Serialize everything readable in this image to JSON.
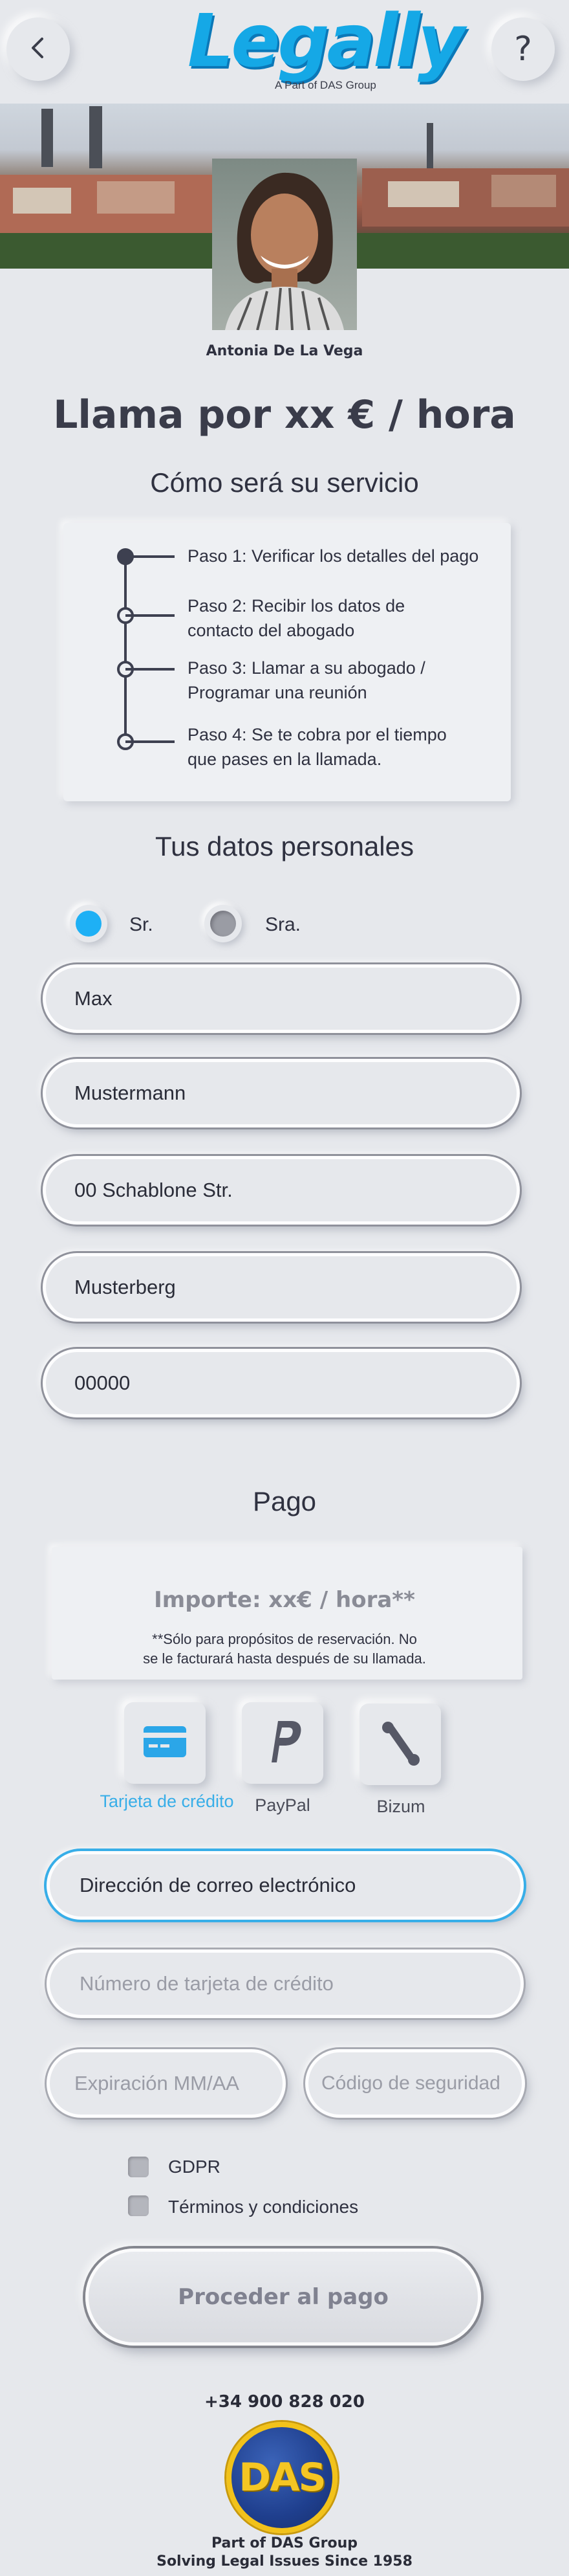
{
  "header": {
    "logo_text": "Legally",
    "logo_sub": "A Part of DAS Group",
    "back_icon": "chevron-left-icon",
    "help_icon": "question-icon"
  },
  "lawyer": {
    "name": "Antonia De La Vega"
  },
  "headline": "Llama por xx € / hora",
  "steps_title": "Cómo será su servicio",
  "steps": [
    {
      "lines": [
        "Paso 1: Verificar los detalles del pago"
      ]
    },
    {
      "lines": [
        "Paso 2: Recibir los datos de",
        "contacto del abogado"
      ]
    },
    {
      "lines": [
        "Paso 3: Llamar a su abogado /",
        "Programar una reunión"
      ]
    },
    {
      "lines": [
        "Paso 4: Se te cobra por el tiempo",
        "que pases en la llamada."
      ]
    }
  ],
  "personal": {
    "title": "Tus datos personales",
    "salutation": {
      "options": [
        "Sr.",
        "Sra."
      ],
      "selected": "Sr.",
      "active_color": "#1eb0f5"
    },
    "fields": [
      "Max",
      "Mustermann",
      "00 Schablone Str.",
      "Musterberg",
      "00000"
    ]
  },
  "payment": {
    "title": "Pago",
    "amount": "Importe: xx€ / hora**",
    "note": [
      "**Sólo para propósitos de reservación. No",
      "se le facturará hasta después de su llamada."
    ],
    "methods": [
      {
        "label": "Tarjeta de crédito",
        "icon": "credit-card-icon",
        "selected": true
      },
      {
        "label": "PayPal",
        "icon": "paypal-icon",
        "selected": false
      },
      {
        "label": "Bizum",
        "icon": "bizum-icon",
        "selected": false
      }
    ],
    "email_placeholder": "Dirección de correo electrónico",
    "card_placeholder": "Número de tarjeta de crédito",
    "expiry_placeholder": "Expiración MM/AA",
    "cvc_placeholder": "Código de seguridad",
    "accent_color": "#38aee8"
  },
  "consents": [
    "GDPR",
    "Términos y condiciones"
  ],
  "cta": "Proceder al pago",
  "footer": {
    "phone": "+34 900 828 020",
    "das_logo_text": "DAS",
    "line1": "Part of DAS Group",
    "line2": "Solving Legal Issues Since 1958"
  }
}
